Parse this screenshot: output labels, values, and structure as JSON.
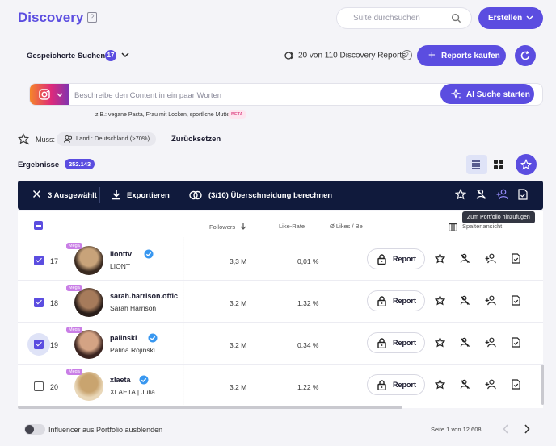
{
  "header": {
    "logo": "Discovery",
    "help": "?",
    "search_placeholder": "Suite durchsuchen",
    "create_label": "Erstellen"
  },
  "saved": {
    "label": "Gespeicherte Suchen",
    "count": "17",
    "reports_text": "20 von 110 Discovery Reports",
    "help": "?",
    "buy_label": "Reports kaufen"
  },
  "ai_search": {
    "placeholder": "Beschreibe den Content in ein paar Worten",
    "button_label": "AI Suche starten",
    "example": "z.B.: vegane Pasta, Frau mit Locken, sportliche Mutter",
    "beta": "BETA"
  },
  "filters": {
    "muss_label": "Muss:",
    "chip": "Land : Deutschland (>70%)",
    "reset": "Zurücksetzen"
  },
  "results": {
    "label": "Ergebnisse",
    "count": "252.143"
  },
  "selection_bar": {
    "selected": "3 Ausgewählt",
    "export": "Exportieren",
    "overlap": "(3/10) Überschneidung berechnen",
    "tooltip": "Zum Portfolio hinzufügen"
  },
  "table": {
    "headers": {
      "followers": "Followers",
      "likerate": "Like-Rate",
      "avg_likes": "Ø Likes / Be",
      "column_view": "Spaltenansicht"
    },
    "report_label": "Report",
    "rows": [
      {
        "num": "17",
        "badge": "Mega",
        "handle": "lionttv",
        "name": "LIONT",
        "followers": "3,3 M",
        "likerate": "0,01 %",
        "checked": true
      },
      {
        "num": "18",
        "badge": "Mega",
        "handle": "sarah.harrison.offic",
        "name": "Sarah Harrison",
        "followers": "3,2 M",
        "likerate": "1,32 %",
        "checked": true
      },
      {
        "num": "19",
        "badge": "Mega",
        "handle": "palinski",
        "name": "Palina Rojinski",
        "followers": "3,2 M",
        "likerate": "0,34 %",
        "checked": true
      },
      {
        "num": "20",
        "badge": "Mega",
        "handle": "xlaeta",
        "name": "XLAETA | Julia",
        "followers": "3,2 M",
        "likerate": "1,22 %",
        "checked": false
      }
    ]
  },
  "footer": {
    "toggle_label": "Influencer aus Portfolio ausblenden",
    "pager": "Seite 1 von 12.608"
  },
  "colors": {
    "accent": "#5b4de0",
    "bar": "#101a3c",
    "background": "#f4f4f8"
  }
}
